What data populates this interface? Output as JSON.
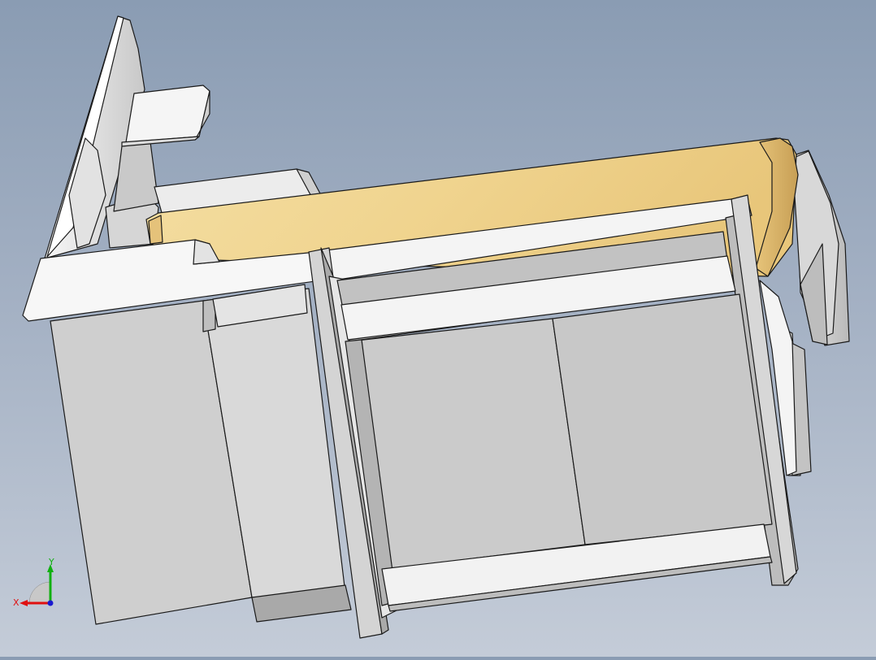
{
  "viewport": {
    "background_top": "#8a9cb3",
    "background_bottom": "#c4ccd8"
  },
  "model": {
    "description_colors": {
      "panel_light": "#f4f4f4",
      "panel_mid": "#d2d2d2",
      "panel_dark": "#a6a6a6",
      "edge": "#1a1a1a",
      "wood": "#f1d898",
      "wood_dark": "#d9b66a"
    }
  },
  "triad": {
    "x_label": "X",
    "y_label": "Y",
    "x_color": "#e01010",
    "y_color": "#10b010",
    "z_color": "#1a1ad0"
  }
}
